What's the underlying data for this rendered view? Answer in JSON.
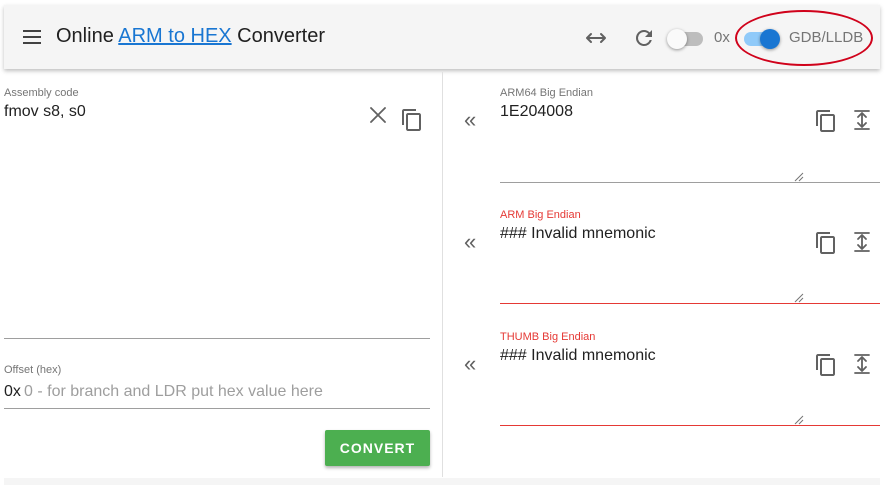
{
  "header": {
    "title_prefix": "Online ",
    "title_link": "ARM to HEX",
    "title_suffix": " Converter",
    "hex_prefix_toggle": {
      "label": "0x",
      "checked": false
    },
    "debugger_toggle": {
      "label": "GDB/LLDB",
      "checked": true
    },
    "icons": [
      "menu-icon",
      "swap-horizontal-icon",
      "refresh-icon"
    ]
  },
  "assembly": {
    "label": "Assembly code",
    "value": "fmov s8, s0"
  },
  "offset": {
    "label": "Offset (hex)",
    "prefix": "0x",
    "placeholder": "0 - for branch and LDR put hex value here"
  },
  "convert_label": "CONVERT",
  "outputs": [
    {
      "label": "ARM64 Big Endian",
      "value": "1E204008",
      "error": false
    },
    {
      "label": "ARM Big Endian",
      "value": "### Invalid mnemonic",
      "error": true
    },
    {
      "label": "THUMB Big Endian",
      "value": "### Invalid mnemonic",
      "error": true
    }
  ],
  "colors": {
    "accent": "#1976d2",
    "error": "#e53935",
    "convert_button": "#4caf50",
    "highlight": "#d0021b"
  }
}
